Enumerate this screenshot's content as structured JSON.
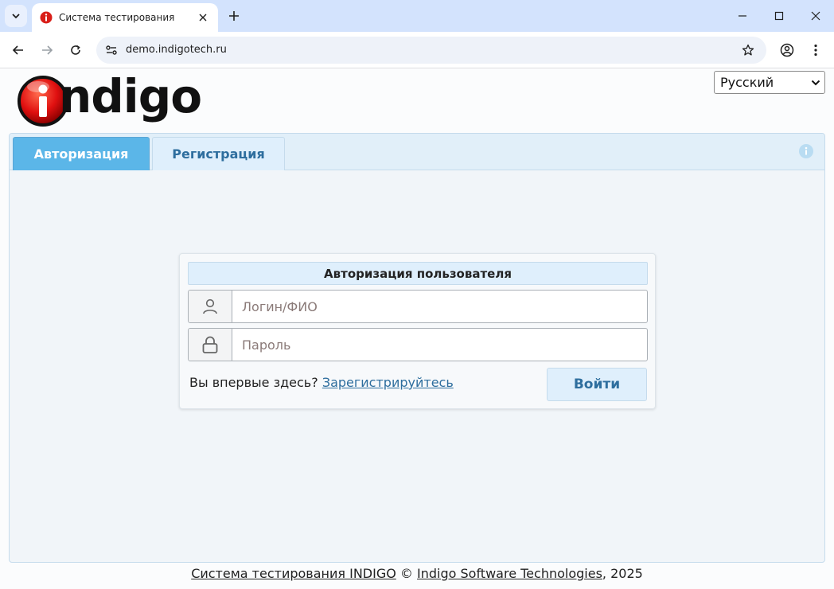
{
  "browser": {
    "tab_title": "Система тестирования",
    "url": "demo.indigotech.ru",
    "favicon_color": "#d91e18"
  },
  "header": {
    "logo_text": "ndigo",
    "language": "Русский"
  },
  "tabs": [
    {
      "label": "Авторизация",
      "active": true
    },
    {
      "label": "Регистрация",
      "active": false
    }
  ],
  "login": {
    "title": "Авторизация пользователя",
    "login_placeholder": "Логин/ФИО",
    "password_placeholder": "Пароль",
    "first_time_text": "Вы впервые здесь?",
    "register_link": "Зарегистрируйтесь",
    "submit_label": "Войти"
  },
  "footer": {
    "system_link": "Система тестирования INDIGO",
    "copyright": "©",
    "company_link": "Indigo Software Technologies",
    "year": ", 2025"
  },
  "colors": {
    "active_tab": "#5bb6e8",
    "accent_text": "#2e6e9e",
    "panel_header": "#e1eff9"
  }
}
